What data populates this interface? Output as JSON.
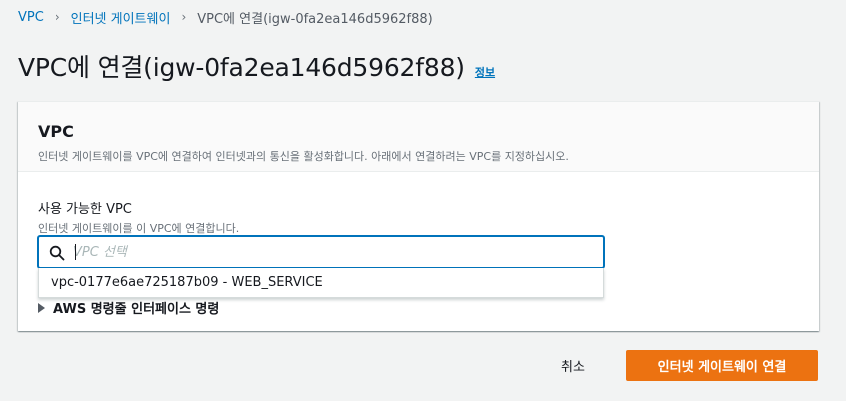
{
  "breadcrumb": {
    "items": [
      "VPC",
      "인터넷 게이트웨이"
    ],
    "current": "VPC에 연결(igw-0fa2ea146d5962f88)"
  },
  "header": {
    "title": "VPC에 연결(igw-0fa2ea146d5962f88)",
    "info_link": "정보"
  },
  "card": {
    "title": "VPC",
    "description": "인터넷 게이트웨이를 VPC에 연결하여 인터넷과의 통신을 활성화합니다. 아래에서 연결하려는 VPC를 지정하십시오.",
    "field_label": "사용 가능한 VPC",
    "field_hint": "인터넷 게이트웨이를 이 VPC에 연결합니다.",
    "search_placeholder": "VPC 선택",
    "dropdown_options": [
      "vpc-0177e6ae725187b09 - WEB_SERVICE"
    ],
    "expander_label": "AWS 명령줄 인터페이스 명령"
  },
  "actions": {
    "cancel_label": "취소",
    "primary_label": "인터넷 게이트웨이 연결"
  },
  "colors": {
    "link": "#0073bb",
    "primary": "#ec7211",
    "background": "#f2f3f3"
  }
}
